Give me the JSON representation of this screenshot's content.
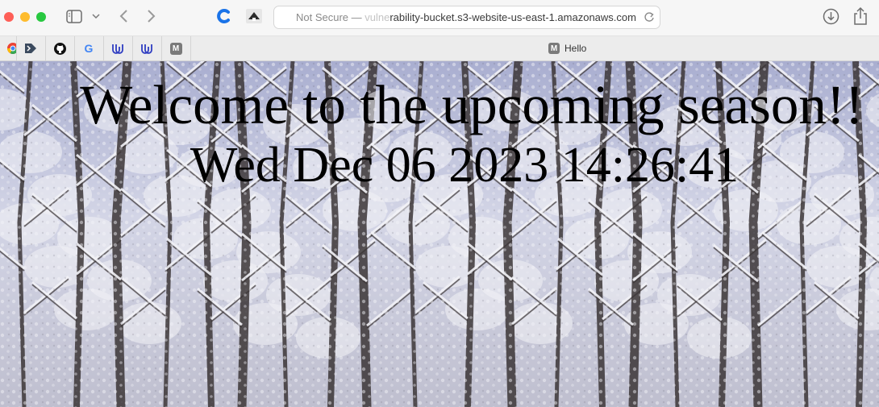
{
  "browser": {
    "address": {
      "prefix": "Not Secure — ",
      "hidden_part": "vulne",
      "url": "rability-bucket.s3-website-us-east-1.amazonaws.com"
    },
    "favorites": [
      {
        "name": "chrome-icon"
      },
      {
        "name": "arrow-icon"
      },
      {
        "name": "github-icon"
      },
      {
        "name": "google-icon",
        "text": "G"
      },
      {
        "name": "udacity-icon"
      },
      {
        "name": "udacity-icon"
      },
      {
        "name": "medium-icon",
        "text": "M"
      }
    ],
    "tab": {
      "badge": "M",
      "title": "Hello"
    }
  },
  "page": {
    "headline": "Welcome to the upcoming season!!",
    "datetime": "Wed Dec 06 2023 14:26:41"
  },
  "colors": {
    "close": "#fe5f57",
    "minimize": "#febc2e",
    "zoom": "#28c840",
    "accent": "#1a73e8",
    "sky": "#c8cde6",
    "snow": "#f2f2f6",
    "bark": "#3b3536"
  }
}
